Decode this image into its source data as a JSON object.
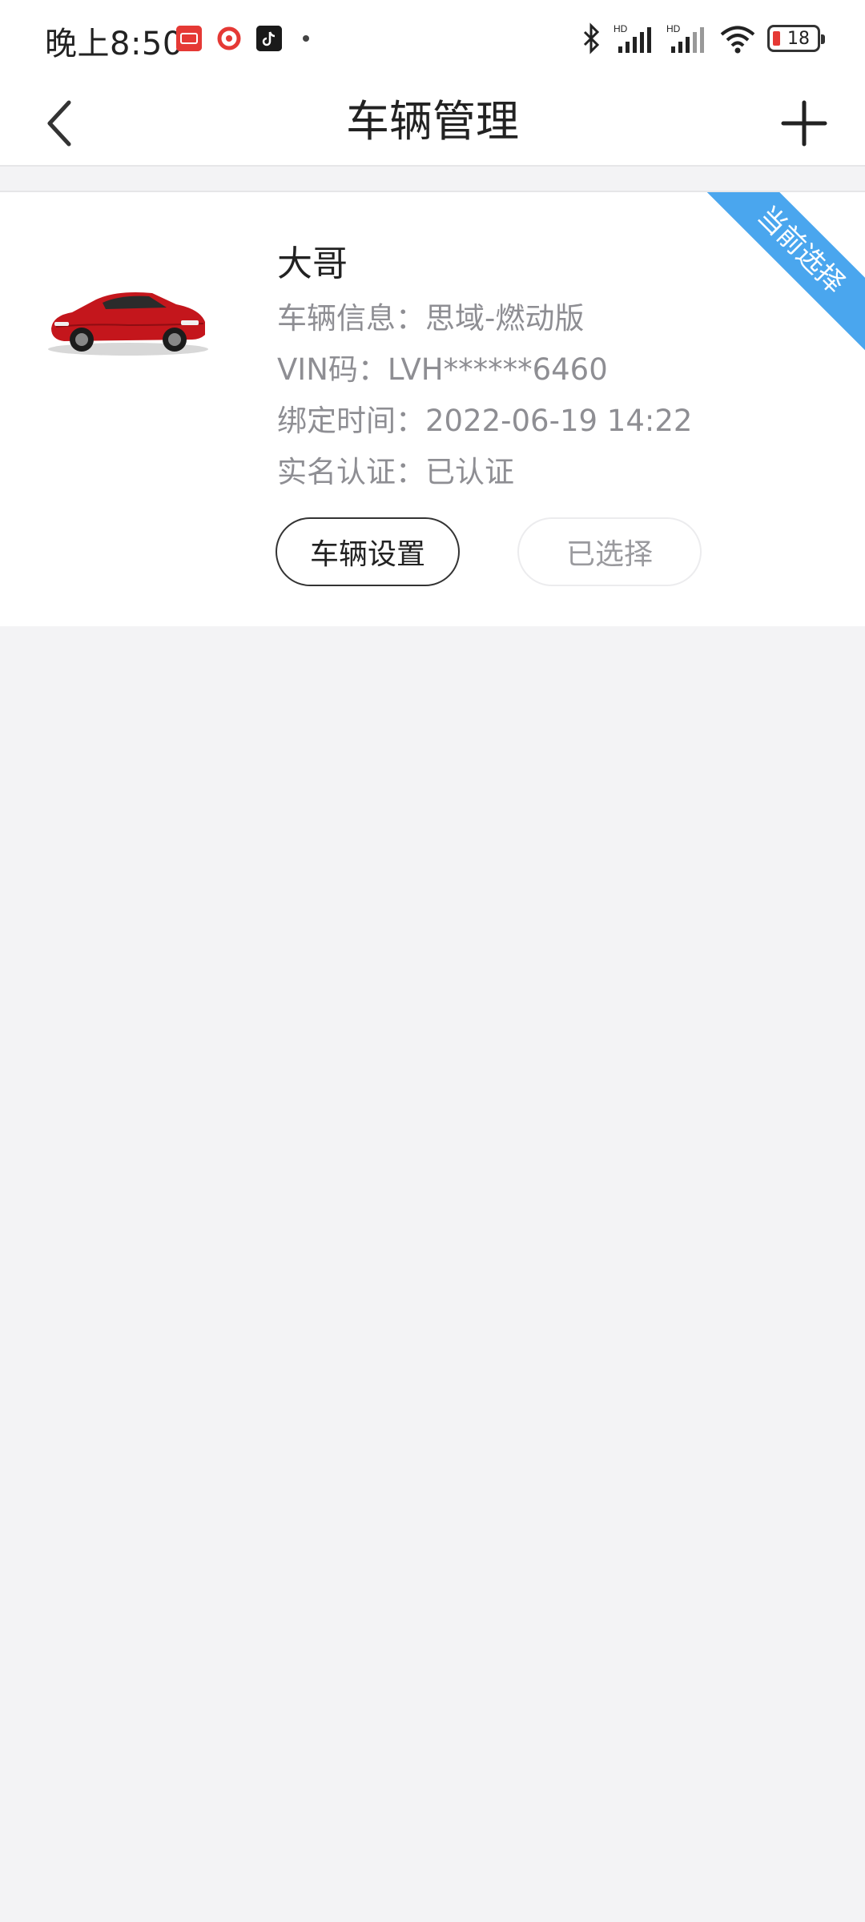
{
  "status_bar": {
    "time": "晚上8:50",
    "notification_icons": [
      "shequ-app-icon",
      "red-play-app-icon",
      "tiktok-icon",
      "more-dot-icon"
    ],
    "battery_level": "18",
    "battery_color": "#e53935"
  },
  "nav": {
    "title": "车辆管理",
    "back_icon": "chevron-left-icon",
    "add_icon": "plus-icon"
  },
  "vehicle_card": {
    "ribbon_label": "当前选择",
    "ribbon_color": "#4aa6ee",
    "owner_name": "大哥",
    "vehicle_info": "车辆信息：思域-燃动版",
    "vin": "VIN码：LVH******6460",
    "bind_time": "绑定时间：2022-06-19 14:22",
    "verification": "实名认证：已认证",
    "settings_button": "车辆设置",
    "selected_button": "已选择",
    "car_color": "#c4161c"
  }
}
